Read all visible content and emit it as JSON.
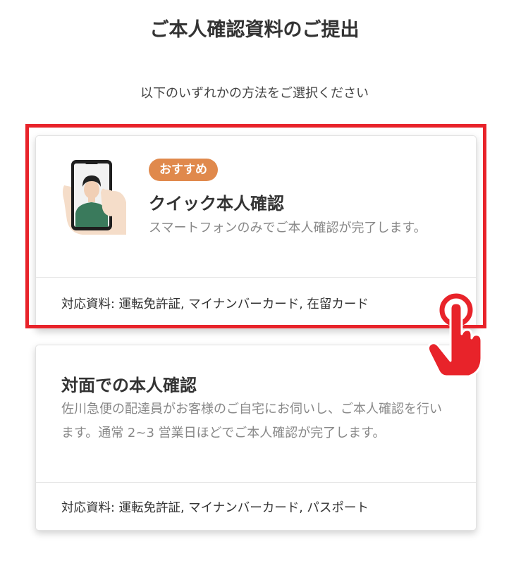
{
  "header": {
    "title": "ご本人確認資料のご提出",
    "subtitle": "以下のいずれかの方法をご選択ください"
  },
  "options": [
    {
      "badge": "おすすめ",
      "title": "クイック本人確認",
      "description": "スマートフォンのみでご本人確認が完了します。",
      "documents": "対応資料: 運転免許証, マイナンバーカード, 在留カード",
      "illustration": "phone-selfie-icon",
      "highlighted": true
    },
    {
      "title": "対面での本人確認",
      "description": "佐川急便の配達員がお客様のご自宅にお伺いし、ご本人確認を行います。通常 2~3 営業日ほどでご本人確認が完了します。",
      "documents": "対応資料: 運転免許証, マイナンバーカード, パスポート"
    }
  ],
  "overlay": {
    "highlight_color": "#e8232a",
    "pointer_icon": "pointing-hand-icon"
  },
  "colors": {
    "badge": "#e0894c",
    "description": "#888888",
    "title": "#333333"
  }
}
